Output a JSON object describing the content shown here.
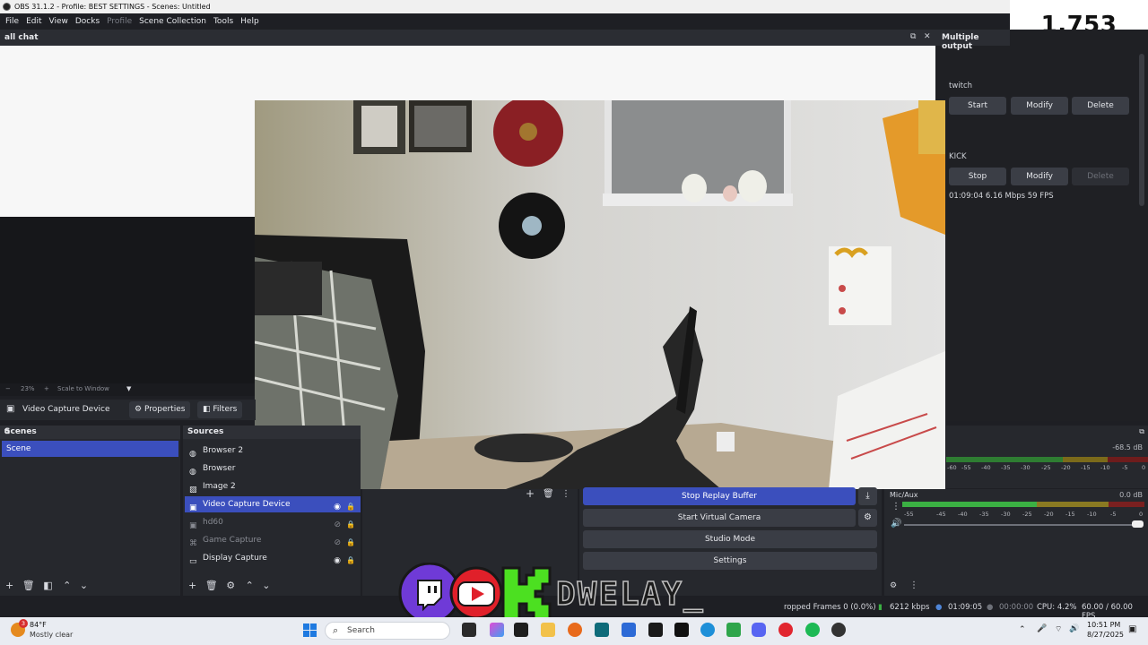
{
  "window": {
    "title": "OBS 31.1.2 - Profile: BEST SETTINGS - Scenes: Untitled"
  },
  "viewer_count": "1,753",
  "menu": [
    "File",
    "Edit",
    "View",
    "Docks",
    "Profile",
    "Scene Collection",
    "Tools",
    "Help"
  ],
  "chat_dock": {
    "title": "all chat"
  },
  "multiple_output": {
    "title": "Multiple output",
    "targets": [
      {
        "name": "twitch",
        "start": "Start",
        "modify": "Modify",
        "delete": "Delete"
      },
      {
        "name": "KICK",
        "start": "Stop",
        "modify": "Modify",
        "delete": "Delete"
      }
    ],
    "stats": "01:09:04  6.16 Mbps  59 FPS"
  },
  "preview": {
    "zoom": "23%",
    "scale": "Scale to Window"
  },
  "source_toolbar": {
    "name": "Video Capture Device",
    "properties": "Properties",
    "filters": "Filters"
  },
  "scenes": {
    "title": "Scenes",
    "items": [
      "Scene"
    ]
  },
  "sources": {
    "title": "Sources",
    "items": [
      "Browser 2",
      "Browser",
      "Image 2",
      "Video Capture Device",
      "hd60",
      "Game Capture",
      "Display Capture"
    ]
  },
  "controls": {
    "replay": "Stop Replay Buffer",
    "virtual_cam": "Start Virtual Camera",
    "studio": "Studio Mode",
    "settings": "Settings"
  },
  "mixer": {
    "track1_db": "-68.5 dB",
    "track2_name": "Mic/Aux",
    "track2_db": "0.0 dB",
    "scale1": [
      "-60",
      "-55",
      "-50",
      "-45",
      "-40",
      "-35",
      "-30",
      "-25",
      "-20",
      "-15",
      "-10",
      "-5",
      "0"
    ],
    "scale2": [
      "-55",
      "-45",
      "-40",
      "-35",
      "-30",
      "-25",
      "-20",
      "-15",
      "-10",
      "-5",
      "0"
    ]
  },
  "status": {
    "dropped": "ropped Frames 0 (0.0%)",
    "bitrate": "6212 kbps",
    "stream_time": "01:09:05",
    "rec_time": "00:00:00",
    "cpu": "CPU: 4.2%",
    "fps": "60.00 / 60.00 FPS"
  },
  "overlay": {
    "brand": "DWELAY_"
  },
  "taskbar": {
    "weather_temp": "84°F",
    "weather_desc": "Mostly clear",
    "weather_badge": "3",
    "search": "Search",
    "time": "10:51 PM",
    "date": "8/27/2025"
  },
  "colors": {
    "accent": "#3b4fbd",
    "panel": "#26282d",
    "taskbar": "#e9ecf2"
  }
}
